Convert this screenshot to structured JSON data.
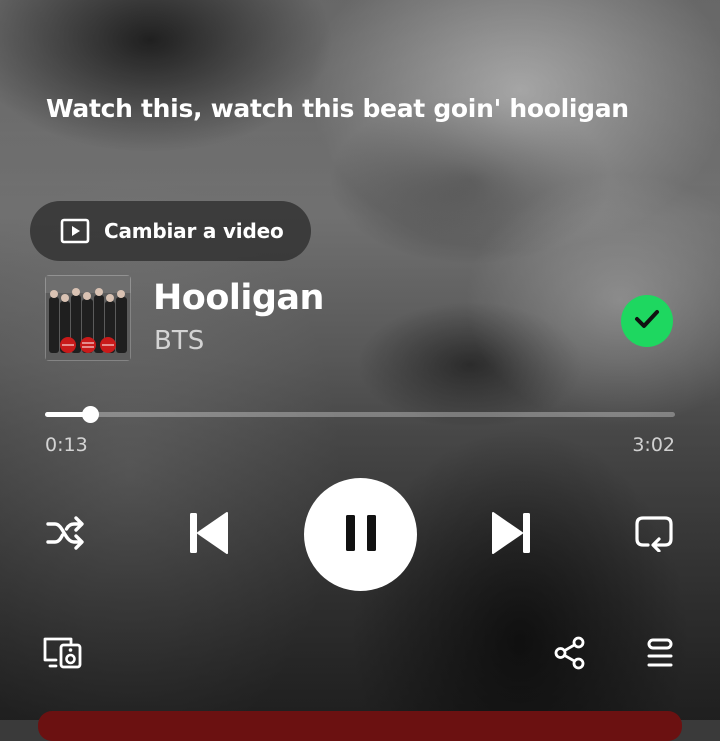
{
  "lyrics": {
    "current_line": "Watch this, watch this beat goin' hooligan"
  },
  "video_toggle": {
    "label": "Cambiar a video",
    "icon": "play-square-icon"
  },
  "track": {
    "title": "Hooligan",
    "artist": "BTS",
    "saved": true,
    "saved_icon": "check-icon"
  },
  "playback": {
    "elapsed": "0:13",
    "duration": "3:02",
    "progress_fraction": 0.0714,
    "state": "playing"
  },
  "controls": {
    "shuffle_icon": "shuffle-icon",
    "previous_icon": "skip-previous-icon",
    "pause_icon": "pause-icon",
    "next_icon": "skip-next-icon",
    "repeat_icon": "repeat-icon",
    "devices_icon": "connect-devices-icon",
    "share_icon": "share-icon",
    "queue_icon": "queue-icon"
  },
  "colors": {
    "accent_green": "#1ed760",
    "bottom_bar": "#6b1111"
  }
}
